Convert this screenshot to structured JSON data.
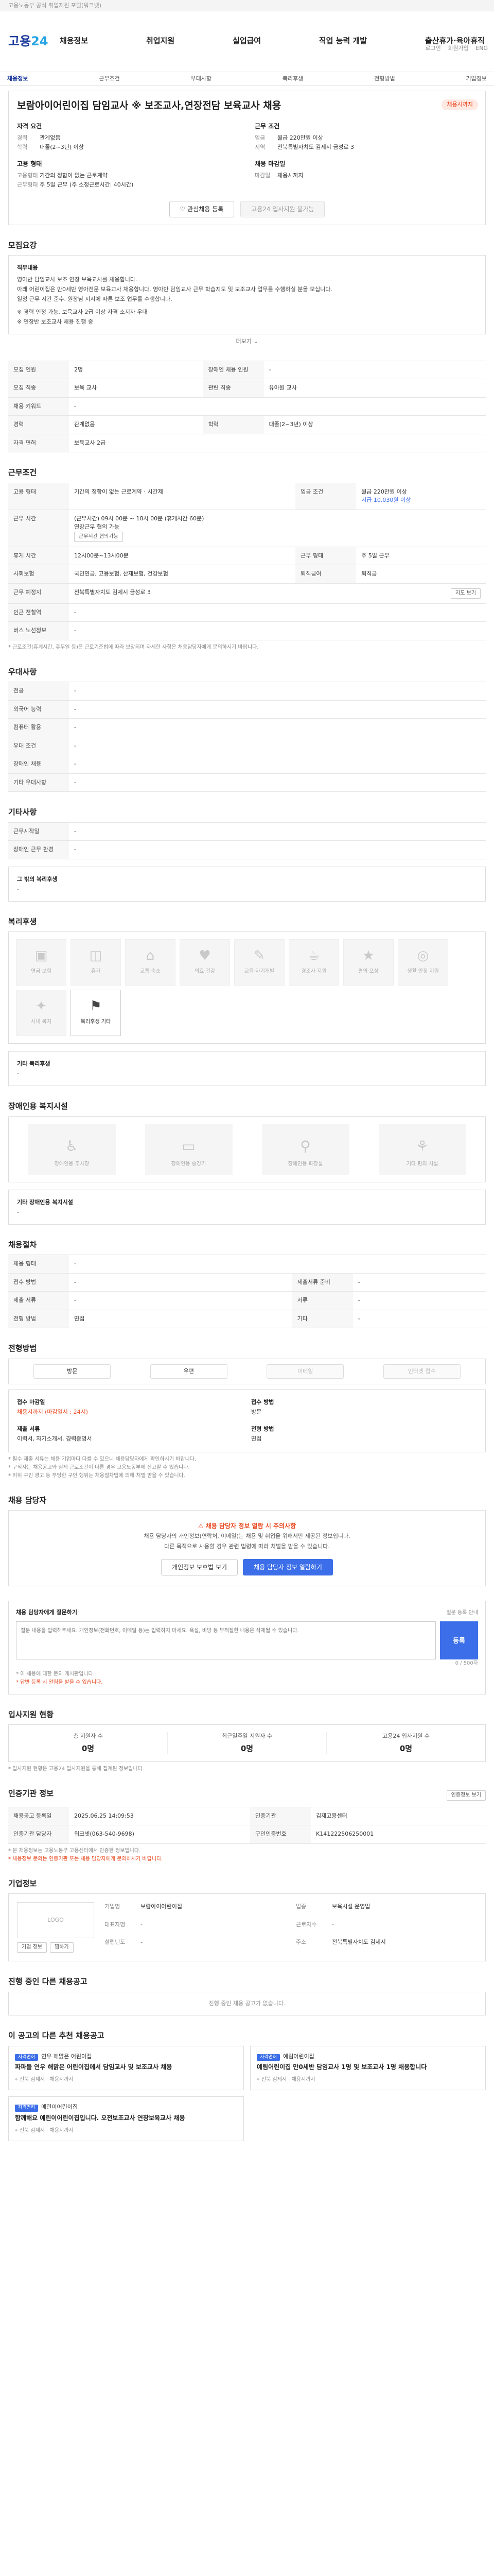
{
  "topbar": {
    "text": "고용노동부 공식 취업지원 포털(워크넷)"
  },
  "header": {
    "logo_main": "고용",
    "logo_num": "24",
    "util": [
      "로그인",
      "회원가입",
      "ENG"
    ],
    "gnb": [
      "채용정보",
      "취업지원",
      "실업급여",
      "직업 능력 개발",
      "출산휴가·육아휴직"
    ]
  },
  "subnav": [
    "채용정보",
    "근무조건",
    "우대사항",
    "복리후생",
    "전형방법",
    "기업정보"
  ],
  "summary": {
    "status": "채용시까지",
    "title": "보람아이어린이집 담임교사 ※ 보조교사,연장전담 보육교사 채용",
    "left_sections": [
      {
        "title": "자격 요건",
        "rows": [
          {
            "k": "경력",
            "v": "관계없음"
          },
          {
            "k": "학력",
            "v": "대졸(2~3년) 이상"
          }
        ]
      },
      {
        "title": "고용 형태",
        "rows": [
          {
            "k": "고용형태",
            "v": "기간의 정함이 없는 근로계약"
          },
          {
            "k": "근무형태",
            "v": "주 5일 근무 (주 소정근로시간: 40시간)"
          }
        ]
      }
    ],
    "right_sections": [
      {
        "title": "근무 조건",
        "rows": [
          {
            "k": "임금",
            "v": "월급 220만원 이상"
          },
          {
            "k": "지역",
            "v": "전북특별자치도 김제시 금성로 3"
          }
        ]
      },
      {
        "title": "채용 마감일",
        "rows": [
          {
            "k": "마감일",
            "v": "채용시까지"
          }
        ]
      }
    ],
    "buttons": {
      "scrap": "관심채용 등록",
      "apply": "고용24 입사지원 불가능"
    }
  },
  "job_description": {
    "title": "모집요강",
    "lines": [
      "직무내용",
      "영아반 담임교사 보조 연장 보육교사를 채용합니다.",
      "아래 어린이집은 만0세반 영아전문 보육교사 채용합니다. 영아반 담임교사 근무 학습지도 및 보조교사 업무를 수행하실 분을 모십니다.",
      "일정 근무 시간 준수. 원장님 지시에 따른 보조 업무를 수행합니다.",
      "※ 경력 인정 가능. 보육교사 2급 이상 자격 소지자 우대",
      "※ 연장반 보조교사 채용 진행 중"
    ],
    "more": "더보기"
  },
  "recruit_table": {
    "rows": [
      [
        {
          "k": "모집 인원",
          "v": "2명"
        },
        {
          "k": "장애인 채용 인원",
          "v": "-"
        }
      ],
      [
        {
          "k": "모집 직종",
          "v": "보육 교사"
        },
        {
          "k": "관련 직종",
          "v": "유아원 교사"
        }
      ],
      [
        {
          "k": "채용 키워드",
          "v": "-"
        },
        {
          "k": "",
          "v": ""
        }
      ],
      [
        {
          "k": "경력",
          "v": "관계없음"
        },
        {
          "k": "학력",
          "v": "대졸(2~3년) 이상"
        }
      ],
      [
        {
          "k": "자격 면허",
          "v": "보육교사 2급"
        },
        {
          "k": "",
          "v": ""
        }
      ]
    ]
  },
  "conditions": {
    "title": "근무조건",
    "employment": {
      "k": "고용 형태",
      "v": "기간의 정함이 없는 근로계약 · 시간제",
      "k2": "임금 조건",
      "v2": "월급 220만원 이상"
    },
    "wage_note": "시급 10,030원 이상",
    "work_time_label": "근무 시간",
    "work_time": [
      "(근무시간) 09시 00분 ~ 18시 00분 (휴게시간 60분)",
      "연장근무 협의 가능"
    ],
    "work_time_badge": "근무시간 협의가능",
    "rows": [
      [
        {
          "k": "휴게 시간",
          "v": "12시00분~13시00분"
        },
        {
          "k": "근무 형태",
          "v": "주 5일 근무"
        }
      ],
      [
        {
          "k": "사회보험",
          "v": "국민연금, 고용보험, 산재보험, 건강보험"
        },
        {
          "k": "퇴직급여",
          "v": "퇴직금"
        }
      ],
      [
        {
          "k": "근무 예정지",
          "v": "전북특별자치도 김제시 금성로 3"
        },
        {
          "k": "",
          "v": ""
        }
      ],
      [
        {
          "k": "인근 전철역",
          "v": "-"
        },
        {
          "k": "",
          "v": ""
        }
      ],
      [
        {
          "k": "버스 노선정보",
          "v": "-"
        },
        {
          "k": "",
          "v": ""
        }
      ]
    ],
    "map_btn": "지도 보기",
    "note": "* 근로조건(휴게시간, 휴무일 등)은 근로기준법에 따라 보장되며 자세한 사항은 채용담당자에게 문의하시기 바랍니다."
  },
  "preferences": {
    "title": "우대사항",
    "rows": [
      {
        "k": "전공",
        "v": "-"
      },
      {
        "k": "외국어 능력",
        "v": "-"
      },
      {
        "k": "컴퓨터 활용",
        "v": "-"
      },
      {
        "k": "우대 조건",
        "v": "-"
      },
      {
        "k": "장애인 채용",
        "v": "-"
      },
      {
        "k": "기타 우대사항",
        "v": "-"
      }
    ]
  },
  "support": {
    "title": "기타사항",
    "rows": [
      {
        "k": "근무시작일",
        "v": "-"
      },
      {
        "k": "장애인 근무 환경",
        "v": "-"
      }
    ],
    "extra_title": "그 밖의 복리후생",
    "extra_value": "-"
  },
  "welfare": {
    "title": "복리후생",
    "items": [
      {
        "icon": "▣",
        "label": "연금·보험",
        "on": false
      },
      {
        "icon": "◫",
        "label": "휴가",
        "on": false
      },
      {
        "icon": "⌂",
        "label": "교통·숙소",
        "on": false
      },
      {
        "icon": "♥",
        "label": "의료·건강",
        "on": false
      },
      {
        "icon": "✎",
        "label": "교육·자기개발",
        "on": false
      },
      {
        "icon": "☕",
        "label": "경조사 지원",
        "on": false
      },
      {
        "icon": "★",
        "label": "편의·포상",
        "on": false
      },
      {
        "icon": "◎",
        "label": "생활 안정 지원",
        "on": false
      },
      {
        "icon": "✦",
        "label": "사내 복지",
        "on": false
      },
      {
        "icon": "⚑",
        "label": "복리후생 기타",
        "on": true
      }
    ],
    "other_title": "기타 복리후생",
    "other_value": "-"
  },
  "disability_welfare": {
    "title": "장애인용 복지시설",
    "items": [
      {
        "icon": "♿",
        "label": "장애인용 주차장"
      },
      {
        "icon": "▭",
        "label": "장애인용 승강기"
      },
      {
        "icon": "⚲",
        "label": "장애인용 화장실"
      },
      {
        "icon": "⚘",
        "label": "기타 편의 시설"
      }
    ],
    "other_title": "기타 장애인용 복지시설",
    "other_value": "-"
  },
  "selection": {
    "title": "채용절차",
    "rows": [
      [
        {
          "k": "채용 형태",
          "v": "-"
        },
        {
          "k": "",
          "v": ""
        }
      ],
      [
        {
          "k": "접수 방법",
          "v": "-"
        },
        {
          "k": "제출서류 준비",
          "v": "-"
        }
      ],
      [
        {
          "k": "제출 서류",
          "v": "-"
        },
        {
          "k": "서류",
          "v": "-"
        }
      ],
      [
        {
          "k": "전형 방법",
          "v": "면접"
        },
        {
          "k": "기타",
          "v": "-"
        }
      ]
    ]
  },
  "apply_method": {
    "title": "전형방법",
    "pills": [
      {
        "label": "방문",
        "on": true
      },
      {
        "label": "우편",
        "on": true
      },
      {
        "label": "이메일",
        "on": false
      },
      {
        "label": "인터넷 접수",
        "on": false
      }
    ],
    "box": [
      {
        "h": "접수 마감일",
        "v": "채용시까지 (마감일시 : 24시)",
        "red": true
      },
      {
        "h": "접수 방법",
        "v": "방문"
      },
      {
        "h": "제출 서류",
        "v": "이력서, 자기소개서, 경력증명서"
      },
      {
        "h": "전형 방법",
        "v": "면접"
      }
    ],
    "notes": [
      "* 필수 제출 서류는 채용 기업마다 다를 수 있으니 채용담당자에게 확인하시기 바랍니다.",
      "* 구직자는 채용공고와 실제 근로조건이 다른 경우 고용노동부에 신고할 수 있습니다.",
      "* 허위 구인 광고 등 부당한 구인 행위는 채용절차법에 의해 처벌 받을 수 있습니다."
    ]
  },
  "contact": {
    "title": "채용 담당자",
    "warn": "채용 담당자 정보 열람 시 주의사항",
    "body": [
      "채용 담당자의 개인정보(연락처, 이메일)는 채용 및 취업을 위해서만 제공된 정보입니다.",
      "다른 목적으로 사용할 경우 관련 법령에 따라 처벌을 받을 수 있습니다."
    ],
    "btn_left": "개인정보 보호법 보기",
    "btn_right": "채용 담당자 정보 열람하기"
  },
  "qa": {
    "title": "채용 담당자에게 질문하기",
    "guide": "질문 등록 안내",
    "placeholder": "질문 내용을 입력해주세요. 개인정보(전화번호, 이메일 등)는 입력하지 마세요. 욕설, 비방 등 부적절한 내용은 삭제될 수 있습니다.",
    "counter": "0 / 500자",
    "register": "등록",
    "notes": [
      "* 이 채용에 대한 문의 게시판입니다.",
      "* 답변 등록 시 알림을 받을 수 있습니다."
    ]
  },
  "applicants": {
    "title": "입사지원 현황",
    "stats": [
      {
        "label": "총 지원자 수",
        "value": "0명"
      },
      {
        "label": "최근일주일 지원자 수",
        "value": "0명"
      },
      {
        "label": "고용24 입사지원 수",
        "value": "0명"
      }
    ],
    "note": "* 입사지원 현황은 고용24 입사지원을 통해 집계된 정보입니다."
  },
  "recruit_info": {
    "title": "인증기관 정보",
    "btn": "인증정보 보기",
    "rows": [
      [
        {
          "k": "채용공고 등록일",
          "v": "2025.06.25 14:09:53"
        },
        {
          "k": "인증기관",
          "v": "김제고용센터"
        }
      ],
      [
        {
          "k": "인증기관 담당자",
          "v": "워크넷(063-540-9698)"
        },
        {
          "k": "구인인증번호",
          "v": "K141222506250001"
        }
      ]
    ],
    "notes": [
      "* 본 채용정보는 고용노동부 고용센터에서 인증한 정보입니다.",
      "* 채용정보 문의는 인증기관 또는 채용 담당자에게 문의하시기 바랍니다."
    ]
  },
  "company": {
    "title": "기업정보",
    "logo": "LOGO",
    "rows": [
      {
        "k": "기업명",
        "v": "보람아이어린이집"
      },
      {
        "k": "업종",
        "v": "보육시설 운영업"
      },
      {
        "k": "대표자명",
        "v": "-"
      },
      {
        "k": "근로자수",
        "v": "-"
      },
      {
        "k": "설립년도",
        "v": "-"
      },
      {
        "k": "주소",
        "v": "전북특별자치도 김제시"
      }
    ],
    "btns": [
      "기업 정보",
      "찜하기"
    ]
  },
  "others": {
    "title": "진행 중인 다른 채용공고",
    "empty": "진행 중인 채용 공고가 없습니다."
  },
  "similar": {
    "title": "이 공고의 다른 추천 채용공고",
    "cards": [
      {
        "tag": "자격면허",
        "company": "연우 해맑은 어린이집",
        "title": "파파돌 연우 해맑은 어린이집에서 담임교사 및 보조교사 채용",
        "location": "전북 김제시",
        "date": "채용시까지"
      },
      {
        "tag": "자격면허",
        "company": "예림어린이집",
        "title": "예림어린이집 만0세반 담임교사 1명 및 보조교사 1명 채용합니다",
        "location": "전북 김제시",
        "date": "채용시까지"
      },
      {
        "tag": "자격면허",
        "company": "예린이어린이집",
        "title": "함께해요 예린이어린이집입니다. 오전보조교사 연장보육교사 채용",
        "location": "전북 김제시",
        "date": "채용시까지"
      }
    ]
  }
}
